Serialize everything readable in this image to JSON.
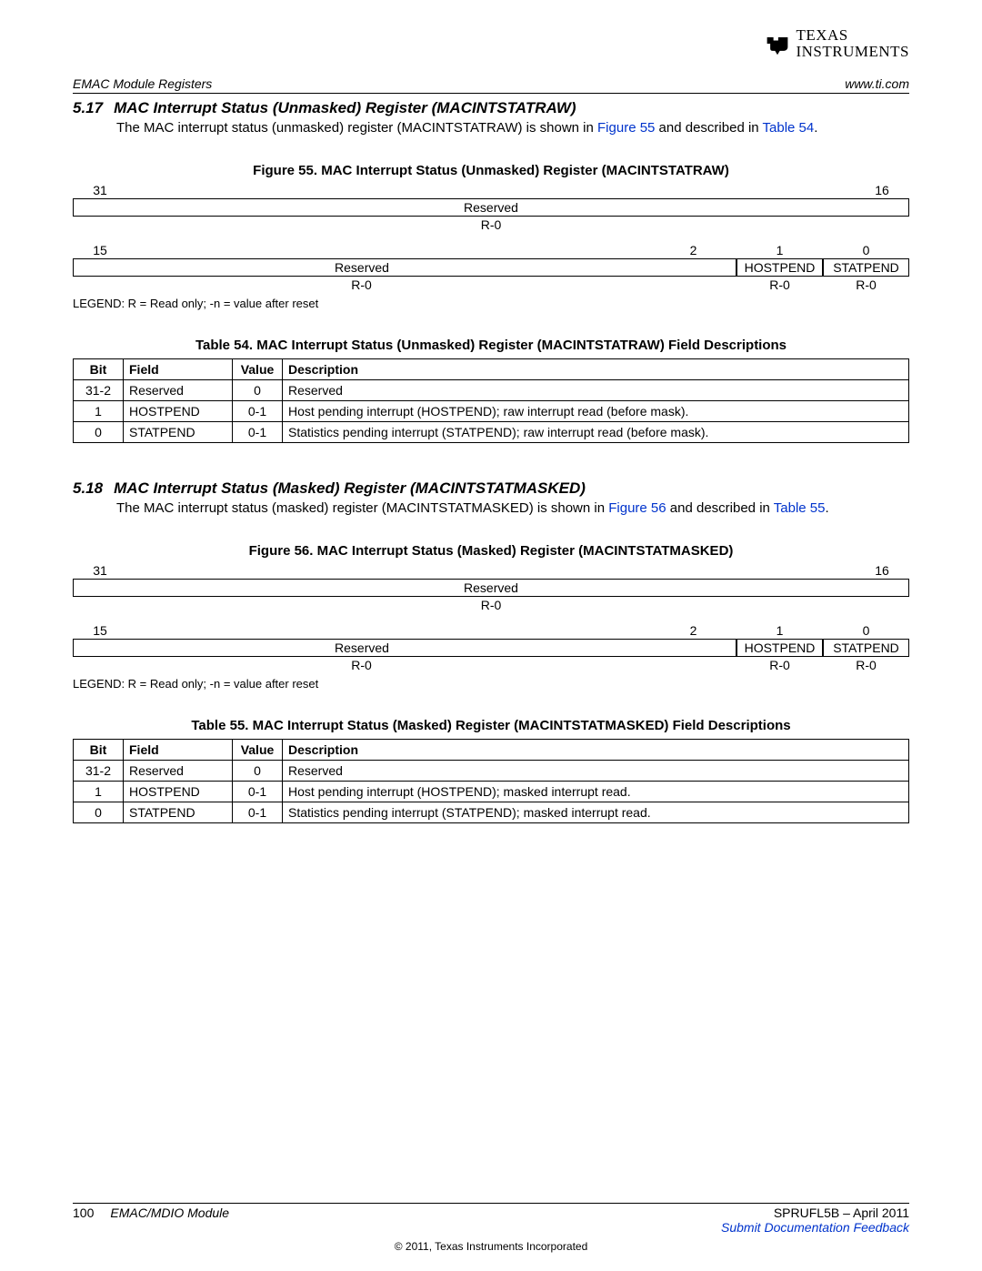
{
  "logo": {
    "brand1": "TEXAS",
    "brand2": "INSTRUMENTS"
  },
  "header": {
    "left": "EMAC Module Registers",
    "right": "www.ti.com"
  },
  "s517": {
    "num": "5.17",
    "title": "MAC Interrupt Status (Unmasked) Register (MACINTSTATRAW)",
    "body_1": "The MAC interrupt status (unmasked) register (MACINTSTATRAW) is shown in ",
    "body_link1": "Figure 55",
    "body_2": " and described in ",
    "body_link2": "Table 54",
    "body_3": ".",
    "fig_title": "Figure 55. MAC Interrupt Status (Unmasked) Register (MACINTSTATRAW)",
    "legend": "LEGEND: R = Read only; -n = value after reset",
    "tab_title": "Table 54. MAC Interrupt Status (Unmasked) Register (MACINTSTATRAW) Field Descriptions",
    "theaders": {
      "bit": "Bit",
      "field": "Field",
      "value": "Value",
      "desc": "Description"
    },
    "rows": [
      {
        "bit": "31-2",
        "field": "Reserved",
        "value": "0",
        "desc": "Reserved"
      },
      {
        "bit": "1",
        "field": "HOSTPEND",
        "value": "0-1",
        "desc": "Host pending interrupt (HOSTPEND); raw interrupt read (before mask)."
      },
      {
        "bit": "0",
        "field": "STATPEND",
        "value": "0-1",
        "desc": "Statistics pending interrupt (STATPEND); raw interrupt read (before mask)."
      }
    ]
  },
  "s518": {
    "num": "5.18",
    "title": "MAC Interrupt Status (Masked) Register (MACINTSTATMASKED)",
    "body_1": "The MAC interrupt status (masked) register (MACINTSTATMASKED) is shown in ",
    "body_link1": "Figure 56",
    "body_2": " and described in ",
    "body_link2": "Table 55",
    "body_3": ".",
    "fig_title": "Figure 56. MAC Interrupt Status (Masked) Register (MACINTSTATMASKED)",
    "legend": "LEGEND: R = Read only; -n = value after reset",
    "tab_title": "Table 55. MAC Interrupt Status (Masked) Register (MACINTSTATMASKED) Field Descriptions",
    "theaders": {
      "bit": "Bit",
      "field": "Field",
      "value": "Value",
      "desc": "Description"
    },
    "rows": [
      {
        "bit": "31-2",
        "field": "Reserved",
        "value": "0",
        "desc": "Reserved"
      },
      {
        "bit": "1",
        "field": "HOSTPEND",
        "value": "0-1",
        "desc": "Host pending interrupt (HOSTPEND); masked interrupt read."
      },
      {
        "bit": "0",
        "field": "STATPEND",
        "value": "0-1",
        "desc": "Statistics pending interrupt (STATPEND); masked interrupt read."
      }
    ]
  },
  "reg": {
    "b31": "31",
    "b16": "16",
    "b15": "15",
    "b2": "2",
    "b1": "1",
    "b0": "0",
    "reserved": "Reserved",
    "r0": "R-0",
    "hostpend": "HOSTPEND",
    "statpend": "STATPEND"
  },
  "footer": {
    "page": "100",
    "module": "EMAC/MDIO Module",
    "docid": "SPRUFL5B – April 2011",
    "feedback": "Submit Documentation Feedback",
    "copyright": "© 2011, Texas Instruments Incorporated"
  }
}
